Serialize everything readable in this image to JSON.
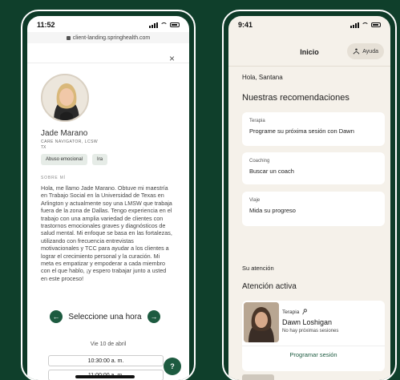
{
  "left_phone": {
    "status_time": "11:52",
    "url": "client-landing.springhealth.com",
    "close_icon": "×",
    "provider": {
      "name": "Jade Marano",
      "role": "CARE NAVIGATOR, LCSW",
      "state": "TX",
      "tags": [
        "Abuso emocional",
        "Ira"
      ]
    },
    "about_label": "SOBRE MÍ",
    "bio": "Hola, me llamo Jade Marano. Obtuve mi maestría en Trabajo Social en la Universidad de Texas en Arlington y actualmente soy una LMSW que trabaja fuera de la zona de Dallas. Tengo experiencia en el trabajo con una amplia variedad de clientes con trastornos emocionales graves y diagnósticos de salud mental. Mi enfoque se basa en las fortalezas, utilizando con frecuencia entrevistas motivacionales y TCC para ayudar a los clientes a lograr el crecimiento personal y la curación. Mi meta es empatizar y empoderar a cada miembro con el que hablo, ¡y espero trabajar junto a usted en este proceso!",
    "select_hour_label": "Seleccione una hora",
    "date_label": "Vie 10 de abril",
    "time_slots": [
      "10:30:00 a. m.",
      "11:00:00 a. m."
    ],
    "help_fab": "?"
  },
  "right_phone": {
    "status_time": "9:41",
    "title": "Inicio",
    "help_label": "Ayuda",
    "greeting": "Hola, Santana",
    "recommendations_heading": "Nuestras recomendaciones",
    "cards": [
      {
        "category": "Terapia",
        "title": "Programe su próxima sesión con Dawn"
      },
      {
        "category": "Coaching",
        "title": "Buscar un coach"
      },
      {
        "category": "Viaje",
        "title": "Mida su progreso"
      }
    ],
    "attention_label": "Su atención",
    "active_attention_heading": "Atención activa",
    "therapist": {
      "category": "Terapia",
      "name": "Dawn Loshigan",
      "status": "No hay próximas sesiones",
      "action": "Programar sesión"
    }
  },
  "colors": {
    "background": "#0f3f2b",
    "accent": "#1d5b40",
    "right_screen": "#f5f1ea"
  }
}
